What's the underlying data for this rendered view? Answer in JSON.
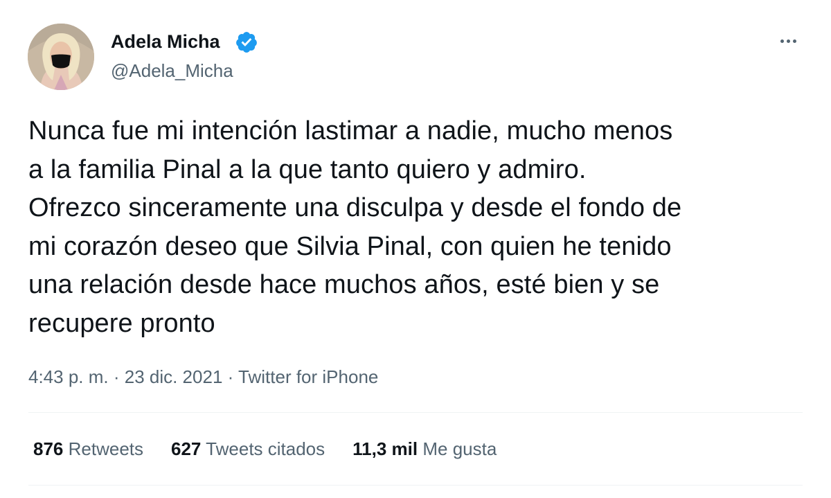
{
  "user": {
    "display_name": "Adela Micha",
    "handle": "@Adela_Micha",
    "verified": true,
    "verified_icon": "verified-badge-icon"
  },
  "tweet": {
    "text": "Nunca fue mi intención lastimar a nadie, mucho menos\na la familia Pinal a la que tanto quiero y admiro.\nOfrezco sinceramente una disculpa y desde el fondo de\nmi corazón deseo que Silvia Pinal, con quien he tenido\nuna relación desde hace muchos años, esté bien y se\nrecupere pronto"
  },
  "meta": {
    "time": "4:43 p. m.",
    "sep1": " · ",
    "date": "23 dic. 2021",
    "sep2": " · ",
    "source": "Twitter for iPhone"
  },
  "stats": {
    "retweets_count": "876",
    "retweets_label": "Retweets",
    "quotes_count": "627",
    "quotes_label": "Tweets citados",
    "likes_count": "11,3 mil",
    "likes_label": "Me gusta"
  },
  "colors": {
    "text_primary": "#0f1419",
    "text_secondary": "#536471",
    "verified_blue": "#1d9bf0",
    "divider": "#eff3f4"
  }
}
